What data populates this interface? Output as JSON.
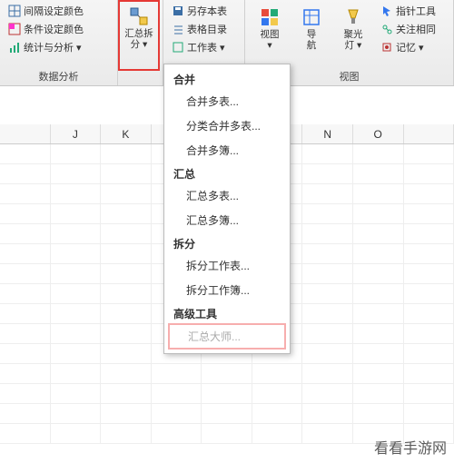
{
  "ribbon": {
    "data_analysis": {
      "interval_color": "间隔设定颜色",
      "conditional_color": "条件设定颜色",
      "stats": "统计与分析 ▾",
      "label": "数据分析"
    },
    "summary_split_btn": "汇总拆\n分 ▾",
    "save_as": "另存本表",
    "toc": "表格目录",
    "worksheet": "工作表 ▾",
    "view_btn": "视图\n▾",
    "nav_btn": "导\n航",
    "spotlight_btn": "聚光\n灯 ▾",
    "pointer_tool": "指针工具",
    "focus_related": "关注相同",
    "memory": "记忆 ▾",
    "view_label": "视图"
  },
  "columns": [
    "",
    "J",
    "K",
    "",
    "",
    "",
    "N",
    "O",
    ""
  ],
  "menu": {
    "sec1": "合并",
    "m1": "合并多表...",
    "m2": "分类合并多表...",
    "m3": "合并多簿...",
    "sec2": "汇总",
    "m4": "汇总多表...",
    "m5": "汇总多簿...",
    "sec3": "拆分",
    "m6": "拆分工作表...",
    "m7": "拆分工作簿...",
    "sec4": "高级工具",
    "m8": "汇总大师..."
  },
  "watermark": "看看手游网"
}
